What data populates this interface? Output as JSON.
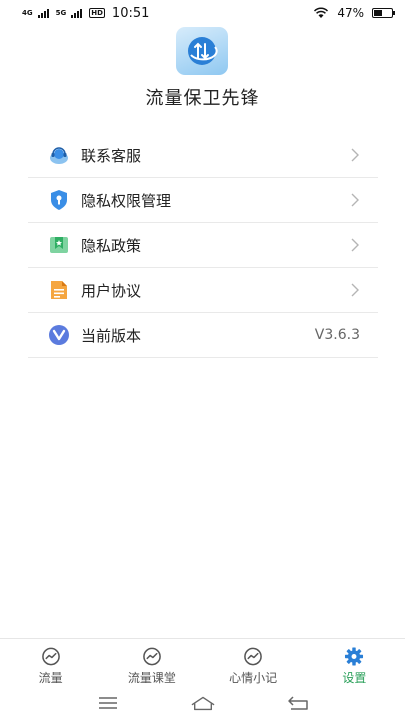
{
  "status_bar": {
    "net1": "4G",
    "net2": "5G",
    "hd": "HD",
    "time": "10:51",
    "battery_text": "47%",
    "battery_level": 0.47
  },
  "app": {
    "logo_icon": "data-swap-logo",
    "title": "流量保卫先锋"
  },
  "menu": {
    "items": [
      {
        "label": "联系客服",
        "icon": "customer-service-icon",
        "color": "#3a8ee6"
      },
      {
        "label": "隐私权限管理",
        "icon": "shield-icon",
        "color": "#3a8ee6"
      },
      {
        "label": "隐私政策",
        "icon": "bookmark-icon",
        "color": "#35b86a"
      },
      {
        "label": "用户协议",
        "icon": "document-icon",
        "color": "#f0922a"
      },
      {
        "label": "当前版本",
        "icon": "version-icon",
        "color": "#5b7bde",
        "value": "V3.6.3"
      }
    ]
  },
  "tabbar": {
    "tabs": [
      {
        "label": "流量",
        "icon": "trend-icon"
      },
      {
        "label": "流量课堂",
        "icon": "trend-icon"
      },
      {
        "label": "心情小记",
        "icon": "trend-icon"
      },
      {
        "label": "设置",
        "icon": "gear-icon",
        "active": true
      }
    ],
    "active_color": "#2aa05a"
  },
  "navbar": {
    "buttons": [
      "menu-icon",
      "home-icon",
      "back-icon"
    ]
  }
}
